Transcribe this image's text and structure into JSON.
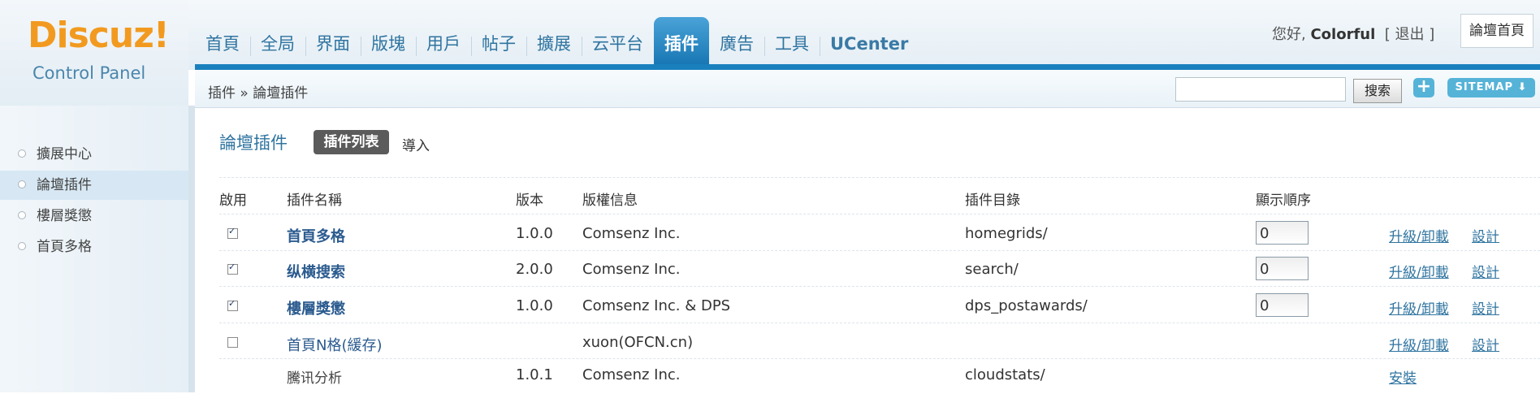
{
  "logo": {
    "title": "Discuz!",
    "subtitle": "Control Panel"
  },
  "nav": {
    "items": [
      {
        "label": "首頁",
        "active": false
      },
      {
        "label": "全局",
        "active": false
      },
      {
        "label": "界面",
        "active": false
      },
      {
        "label": "版塊",
        "active": false
      },
      {
        "label": "用戶",
        "active": false
      },
      {
        "label": "帖子",
        "active": false
      },
      {
        "label": "擴展",
        "active": false
      },
      {
        "label": "云平台",
        "active": false
      },
      {
        "label": "插件",
        "active": true
      },
      {
        "label": "廣告",
        "active": false
      },
      {
        "label": "工具",
        "active": false
      },
      {
        "label": "UCenter",
        "active": false
      }
    ]
  },
  "user": {
    "greeting": "您好,",
    "name": "Colorful",
    "logout_open": "[",
    "logout": "退出",
    "logout_close": "]",
    "forum_home": "論壇首頁"
  },
  "subbar": {
    "breadcrumb": "插件 » 論壇插件",
    "search_button": "搜索",
    "add_label": "+",
    "sitemap_label": "SITEMAP ⬇"
  },
  "sidebar": {
    "items": [
      {
        "label": "擴展中心",
        "active": false
      },
      {
        "label": "論壇插件",
        "active": true
      },
      {
        "label": "樓層獎懲",
        "active": false
      },
      {
        "label": "首頁多格",
        "active": false
      }
    ]
  },
  "main": {
    "title": "論壇插件",
    "tab_list": "插件列表",
    "tab_import": "導入",
    "columns": {
      "enabled": "啟用",
      "name": "插件名稱",
      "version": "版本",
      "copyright": "版權信息",
      "directory": "插件目錄",
      "order": "顯示順序"
    },
    "rows": [
      {
        "enabled": true,
        "name": "首頁多格",
        "version": "1.0.0",
        "copyright": "Comsenz Inc.",
        "directory": "homegrids/",
        "order": "0",
        "action1": "升級/卸載",
        "action2": "設計"
      },
      {
        "enabled": true,
        "name": "纵横搜索",
        "version": "2.0.0",
        "copyright": "Comsenz Inc.",
        "directory": "search/",
        "order": "0",
        "action1": "升級/卸載",
        "action2": "設計"
      },
      {
        "enabled": true,
        "name": "樓層獎懲",
        "version": "1.0.0",
        "copyright": "Comsenz Inc. & DPS",
        "directory": "dps_postawards/",
        "order": "0",
        "action1": "升級/卸載",
        "action2": "設計"
      },
      {
        "enabled": false,
        "name": "首頁N格(緩存)",
        "version": "",
        "copyright": "xuon(OFCN.cn)",
        "directory": "",
        "order": "",
        "action1": "升級/卸載",
        "action2": "設計"
      },
      {
        "enabled": null,
        "name": "騰讯分析",
        "version": "1.0.1",
        "copyright": "Comsenz Inc.",
        "directory": "cloudstats/",
        "order": "",
        "action1": "安裝",
        "action2": ""
      }
    ]
  }
}
